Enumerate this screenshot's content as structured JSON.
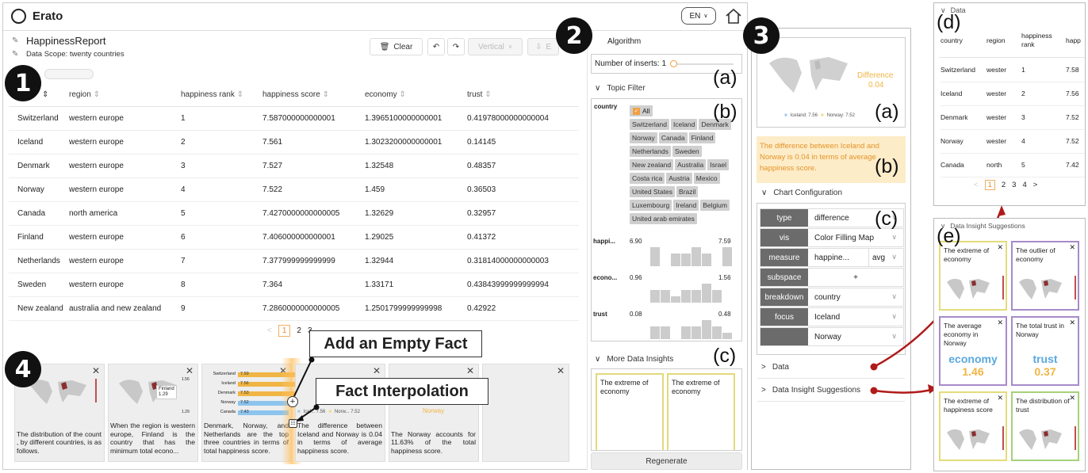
{
  "app": {
    "title": "Erato",
    "lang": "EN",
    "report": "HappinessReport",
    "scope": "Data Scope: twenty countries"
  },
  "toolbar": {
    "clear": "Clear",
    "vertical": "Vertical",
    "e": "E"
  },
  "markers": {
    "m1": "1",
    "m2": "2",
    "m3": "3",
    "m4": "4",
    "a": "(a)",
    "b": "(b)",
    "c": "(c)",
    "d": "(d)",
    "e": "(e)"
  },
  "callouts": {
    "empty": "Add an Empty Fact",
    "interp": "Fact Interpolation"
  },
  "table": {
    "columns": [
      "region",
      "happiness rank",
      "happiness score",
      "economy",
      "trust"
    ],
    "rows": [
      [
        "Switzerland",
        "western europe",
        "1",
        "7.587000000000001",
        "1.3965100000000001",
        "0.41978000000000004"
      ],
      [
        "Iceland",
        "western europe",
        "2",
        "7.561",
        "1.3023200000000001",
        "0.14145"
      ],
      [
        "Denmark",
        "western europe",
        "3",
        "7.527",
        "1.32548",
        "0.48357"
      ],
      [
        "Norway",
        "western europe",
        "4",
        "7.522",
        "1.459",
        "0.36503"
      ],
      [
        "Canada",
        "north america",
        "5",
        "7.4270000000000005",
        "1.32629",
        "0.32957"
      ],
      [
        "Finland",
        "western europe",
        "6",
        "7.406000000000001",
        "1.29025",
        "0.41372"
      ],
      [
        "Netherlands",
        "western europe",
        "7",
        "7.377999999999999",
        "1.32944",
        "0.31814000000000003"
      ],
      [
        "Sweden",
        "western europe",
        "8",
        "7.364",
        "1.33171",
        "0.43843999999999994"
      ],
      [
        "New zealand",
        "australia and new zealand",
        "9",
        "7.2860000000000005",
        "1.2501799999999998",
        "0.42922"
      ]
    ],
    "pages": [
      "1",
      "2",
      "3"
    ]
  },
  "facts": [
    {
      "text": "The distribution of the count , by different countries, is as follows."
    },
    {
      "text": "When the region is western europe, Finland is the country that has the minimum total econo...",
      "map_label": "Finland",
      "map_value": "1.29",
      "axis_top": "1.56",
      "axis_bot": "1.29"
    },
    {
      "text": "Denmark, Norway, and Netherlands are the top three countries in terms of total happiness score.",
      "bars": [
        {
          "name": "Switzerland",
          "value": "7.59"
        },
        {
          "name": "Iceland",
          "value": "7.56"
        },
        {
          "name": "Denmark",
          "value": "7.53"
        },
        {
          "name": "Norway",
          "value": "7.52"
        },
        {
          "name": "Canada",
          "value": "7.43"
        }
      ]
    },
    {
      "text": "The difference between Iceland and Norway is 0.04 in terms of average happiness score.",
      "legend_a": "Icel... 7.56",
      "legend_b": "Norw... 7.52"
    },
    {
      "text": "The Norway accounts for 11.63% of the total happiness score.",
      "label": "Norway"
    },
    {
      "text": ""
    }
  ],
  "algorithm": {
    "title": "Algorithm",
    "inserts": "Number of inserts: 1"
  },
  "topic": {
    "title": "Topic Filter",
    "country_label": "country",
    "all": "All",
    "countries": [
      "Switzerland",
      "Iceland",
      "Denmark",
      "Norway",
      "Canada",
      "Finland",
      "Netherlands",
      "Sweden",
      "New zealand",
      "Australia",
      "Israel",
      "Costa rica",
      "Austria",
      "Mexico",
      "United States",
      "Brazil",
      "Luxembourg",
      "Ireland",
      "Belgium",
      "United arab emirates"
    ],
    "ranges": [
      {
        "label": "happi...",
        "min": "6.90",
        "max": "7.59"
      },
      {
        "label": "econo...",
        "min": "0.96",
        "max": "1.56"
      },
      {
        "label": "trust",
        "min": "0.08",
        "max": "0.48"
      }
    ]
  },
  "more": {
    "title": "More Data Insights",
    "cards": [
      "The extreme of economy",
      "The extreme of economy"
    ],
    "regenerate": "Regenerate"
  },
  "detail": {
    "chart_title": "Difference",
    "chart_value": "0.04",
    "legend_a": "Iceland: 7.56",
    "legend_b": "Norway: 7.52",
    "caption": "The difference between Iceland and Norway is 0.04 in terms of average happiness score.",
    "config_title": "Chart Configuration",
    "config": [
      {
        "k": "type",
        "v": "difference"
      },
      {
        "k": "vis",
        "v": "Color Filling Map"
      },
      {
        "k": "measure",
        "v": "happine...",
        "v2": "avg"
      },
      {
        "k": "subspace",
        "v": "+"
      },
      {
        "k": "breakdown",
        "v": "country"
      },
      {
        "k": "focus",
        "v": "Iceland"
      },
      {
        "k": "",
        "v": "Norway"
      }
    ],
    "data_sec": "Data",
    "sugg_sec": "Data Insight Suggestions"
  },
  "dataPanel": {
    "title": "Data",
    "cols": [
      "country",
      "region",
      "happiness rank",
      "happ"
    ],
    "rows": [
      [
        "Switzerland",
        "wester",
        "1",
        "7.58"
      ],
      [
        "Iceland",
        "wester",
        "2",
        "7.56"
      ],
      [
        "Denmark",
        "wester",
        "3",
        "7.52"
      ],
      [
        "Norway",
        "wester",
        "4",
        "7.52"
      ],
      [
        "Canada",
        "north",
        "5",
        "7.42"
      ]
    ],
    "pages": [
      "1",
      "2",
      "3",
      "4"
    ]
  },
  "suggPanel": {
    "title": "Data Insight Suggestions",
    "cards": [
      {
        "title": "The extreme of economy",
        "color": "#e3dc7a"
      },
      {
        "title": "The outlier of economy",
        "color": "#a78bc9"
      },
      {
        "title": "The average economy in Norway",
        "color": "#a78bc9",
        "big": "economy",
        "val": "1.46",
        "bigColor": "#5aa8de",
        "valColor": "#f0b544"
      },
      {
        "title": "The total trust in Norway",
        "color": "#a78bc9",
        "big": "trust",
        "val": "0.37",
        "bigColor": "#5aa8de",
        "valColor": "#f0b544"
      },
      {
        "title": "The extreme of happiness score",
        "color": "#e3dc7a"
      },
      {
        "title": "The distribution of trust",
        "color": "#a6d17a"
      }
    ]
  }
}
